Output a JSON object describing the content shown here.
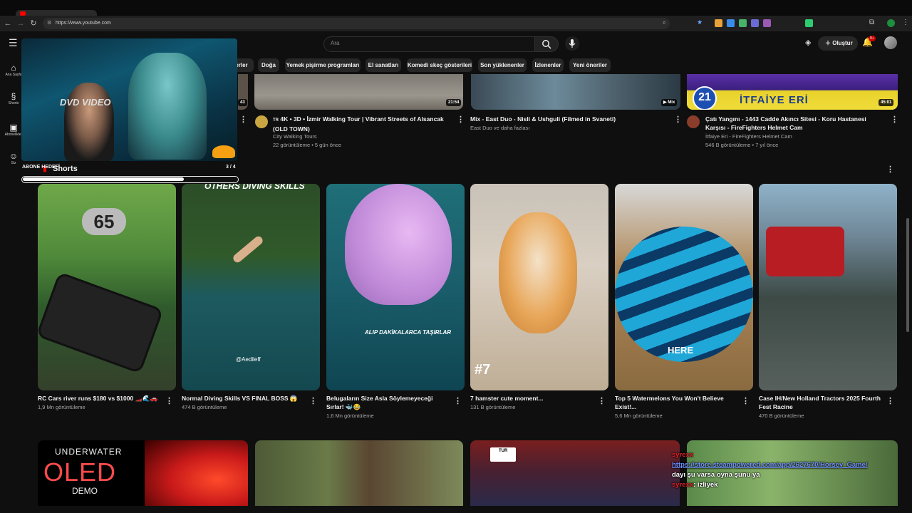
{
  "browser": {
    "url": "https://www.youtube.com"
  },
  "header": {
    "search_placeholder": "Ara",
    "create_label": "Oluştur",
    "notif_count": "9+"
  },
  "sidebar": [
    {
      "label": "Ana Sayfa",
      "icon": "home-icon"
    },
    {
      "label": "Shorts",
      "icon": "shorts-icon"
    },
    {
      "label": "Abonelikler",
      "icon": "subscriptions-icon"
    },
    {
      "label": "Siz",
      "icon": "you-icon"
    }
  ],
  "chips": [
    "Doğa",
    "Yemek pişirme programları",
    "El sanatları",
    "Komedi skeç gösterileri",
    "Son yüklenenler",
    "İzlenenler",
    "Yeni öneriler"
  ],
  "partial_chip": "erler",
  "videos": [
    {
      "duration": "21:54",
      "badge": "TR",
      "title": "4K • 3D • İzmir Walking Tour | Vibrant Streets of Alsancak (OLD TOWN)",
      "channel": "City Walking Tours",
      "meta": "22 görüntüleme • 5 gün önce"
    },
    {
      "duration": "Mix",
      "title": "Mix - East Duo - Nisli & Ushguli (Filmed in Svaneti)",
      "channel": "East Duo ve daha fazlası",
      "meta": ""
    },
    {
      "duration": "45:01",
      "title": "Çatı Yangını - 1443 Cadde Akıncı Sitesi - Koru Hastanesi Karşısı - FireFighters Helmet Cam",
      "channel": "İtfaiye Eri - FireFighters Helmet Cam",
      "meta": "546 B görüntüleme • 7 yıl önce",
      "thumb_text": "İTFAİYE ERİ",
      "thumb_number": "21"
    }
  ],
  "partial_duration": "43",
  "shorts_heading": "Shorts",
  "shorts": [
    {
      "title": "RC Cars river runs $180 vs $1000 🏎️🌊🚗",
      "views": "1,9 Mn görüntüleme",
      "overlay": "65"
    },
    {
      "title": "Normal Diving Skills VS FINAL BOSS 😱",
      "views": "474 B görüntüleme",
      "overlay": "OTHERS DIVING SKILLS",
      "handle": "@Aedileff"
    },
    {
      "title": "Belugaların Size Asla Söylemeyeceği Sırlar! 🐳😂",
      "views": "1,6 Mn görüntüleme",
      "overlay": "ALIP DAKİKALARCA TAŞIRLAR"
    },
    {
      "title": "7 hamster cute moment...",
      "views": "131 B görüntüleme",
      "overlay": "#7"
    },
    {
      "title": "Top 5 Watermelons You Won't Believe Exist!...",
      "views": "5,6 Mn görüntüleme",
      "overlay": "HERE"
    },
    {
      "title": "Case IH/New Holland Tractors 2025 Fourth Fest Racine",
      "views": "470 B görüntüleme",
      "overlay": ""
    }
  ],
  "bottom_row": [
    {
      "line1": "UNDERWATER",
      "line2": "OLED",
      "line3": "DEMO"
    },
    {},
    {
      "scoreboard": "TUR"
    },
    {}
  ],
  "overlay": {
    "webcam_logo": "DVD VIDEO",
    "goal_label": "ABONE HEDEFİ",
    "goal_progress_text": "3 / 4",
    "goal_fraction": 0.75
  },
  "chat": [
    {
      "user": "syrexx",
      "text": "https://store.steampowered.com/app/2627670/Horsey_Game/"
    },
    {
      "user": "",
      "text": "dayı şu varsa oyna şunu ya"
    },
    {
      "user": "syrexx",
      "text": ": izliyek"
    }
  ],
  "colors": {
    "accent_red": "#ff0000",
    "chat_user": "#e0202a",
    "chat_link": "#6e8fff"
  }
}
